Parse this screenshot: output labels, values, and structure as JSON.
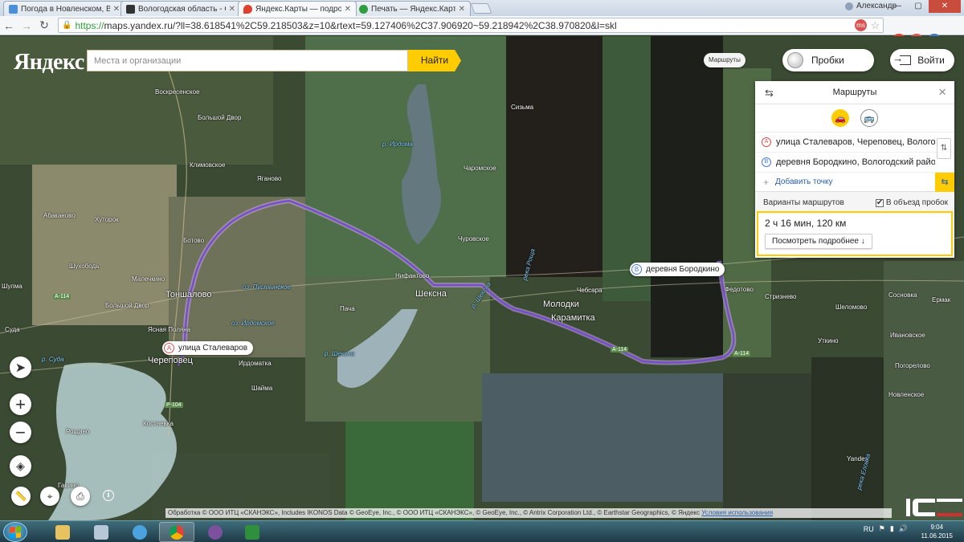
{
  "browser": {
    "tabs": [
      {
        "label": "Погода в Новленском, Во",
        "color": "#4a90d9"
      },
      {
        "label": "Вологодская область - С",
        "color": "#333333"
      },
      {
        "label": "Яндекс.Карты — подробн",
        "color": "#e04030"
      },
      {
        "label": "Печать — Яндекс.Карты",
        "color": "#2e9d3c"
      }
    ],
    "profile_name": "Александр",
    "url_scheme": "https://",
    "url_rest": "maps.yandex.ru/?ll=38.618541%2C59.218503&z=10&rtext=59.127406%2C37.906920~59.218942%2C38.970820&l=skl",
    "window_buttons": {
      "minimize": "—",
      "maximize": "▢",
      "close": "✕"
    }
  },
  "header": {
    "logo": "Яндекс",
    "search_placeholder": "Места и организации",
    "search_button": "Найти",
    "routes_chip": "Маршруты",
    "traffic_label": "Пробки",
    "login_label": "Войти"
  },
  "route_panel": {
    "title": "Маршруты",
    "point_a_letter": "A",
    "point_a": "улица Сталеваров, Череповец, Вологодская область",
    "point_b_letter": "B",
    "point_b": "деревня Бородкино, Вологодский район",
    "add_point": "Добавить точку",
    "variants_label": "Варианты маршрутов",
    "avoid_traffic": "В объезд пробок",
    "avoid_traffic_checked": true,
    "result_time": "2 ч 16 мин, 120 км",
    "result_more": "Посмотреть подробнее ↓"
  },
  "map": {
    "marker_a": {
      "letter": "A",
      "label": "улица Сталеваров"
    },
    "marker_b": {
      "letter": "B",
      "label": "деревня Бородкино"
    },
    "places": {
      "voskresenskoe": "Воскресенское",
      "bolshoy_dvor_n": "Большой Двор",
      "klimovskoe": "Климовское",
      "yaganovo": "Яганово",
      "abakanovo": "Абаканово",
      "khutorok": "Хуторок",
      "botovo": "Ботово",
      "shukhobod": "Шухободь",
      "shulma": "Шулма",
      "malechkino": "Малечкино",
      "tonshalovo": "Тоншалово",
      "bolshoy_dvor": "Большой Двор",
      "yasnaya_polyana": "Ясная Поляна",
      "suda": "Суда",
      "cherepovets": "Череповец",
      "irdomatka": "Ирдоматка",
      "shaima": "Шайма",
      "kostyaevka": "Костяевка",
      "roshchino": "Рощино",
      "gavino": "Гавино",
      "nifantovo": "Нифантово",
      "sheksna": "Шексна",
      "pacha": "Пача",
      "churovskoe": "Чуровское",
      "charomskoe": "Чаромское",
      "sizma": "Сизьма",
      "chebsara": "Чебсара",
      "molodki": "Молодки",
      "karamitka": "Карамитка",
      "fedotovo": "Федотово",
      "strizhevo": "Стризнево",
      "shelomovo": "Шеломово",
      "sosnovka": "Сосновка",
      "utkino": "Уткино",
      "ermak": "Ермак",
      "ivanovskoe": "Ивановское",
      "pogorelovo": "Погорелово",
      "novlenskoe": "Новленское",
      "yandex": "Yandex",
      "river_irdoma": "р. Ирдома",
      "river_sheksna": "р. Шексна",
      "river_sheksna2": "р. Шексна",
      "river_suda": "р. Суда",
      "river_rotsha": "река Роща",
      "river_elovka": "река Еловка",
      "lake_pustynskoe": "оз. Пустынское",
      "lake_irdomskoe": "оз. Ирдомское",
      "road_a114": "А-114",
      "road_a114b": "А-114",
      "road_a114c": "А-114",
      "road_r104": "Р-104"
    },
    "copyright": "Обработка © ООО ИТЦ «СКАНЭКС», Includes IKONOS Data © GeoEye, Inc., © ООО ИТЦ «СКАНЭКС», © GeoEye, Inc., © Antrix Corporation Ltd., © Earthstar Geographics, © Яндекс",
    "terms": "Условия использования"
  },
  "taskbar": {
    "language": "RU",
    "time": "9:04",
    "date": "11.06.2015"
  }
}
